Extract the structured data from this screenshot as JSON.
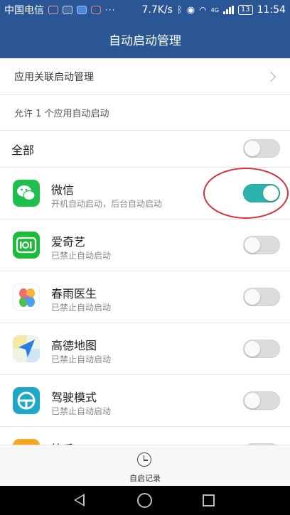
{
  "status_bar": {
    "carrier": "中国电信",
    "more": "···",
    "speed": "7.7K/s",
    "network": "4G",
    "battery": "13",
    "time": "11:54"
  },
  "header": {
    "title": "自动启动管理"
  },
  "linked_startup": {
    "label": "应用关联启动管理"
  },
  "summary": {
    "text": "允许 1 个应用自动启动"
  },
  "all_toggle": {
    "label": "全部",
    "on": false
  },
  "apps": [
    {
      "name": "微信",
      "status": "开机自动启动，后台自动启动",
      "icon": "wechat-icon",
      "on": true,
      "color": "#1dbf4f"
    },
    {
      "name": "爱奇艺",
      "status": "已禁止自动启动",
      "icon": "iqiyi-icon",
      "on": false,
      "color": "#1cbb3a"
    },
    {
      "name": "春雨医生",
      "status": "已禁止自动启动",
      "icon": "petals-icon",
      "on": false,
      "color": "#f8b23a"
    },
    {
      "name": "高德地图",
      "status": "已禁止自动启动",
      "icon": "map-arrow-icon",
      "on": false,
      "color": "#2a7ee8"
    },
    {
      "name": "驾驶模式",
      "status": "已禁止自动启动",
      "icon": "steering-wheel-icon",
      "on": false,
      "color": "#1ea8c8"
    },
    {
      "name": "快手",
      "status": "",
      "icon": "kuaishou-icon",
      "on": false,
      "color": "#f5a623"
    }
  ],
  "bottom_bar": {
    "label": "自启记录",
    "icon": "clock-icon"
  },
  "colors": {
    "header_bg": "#2a5696",
    "toggle_on": "#2bb3ad",
    "annotation": "#d8303a"
  }
}
